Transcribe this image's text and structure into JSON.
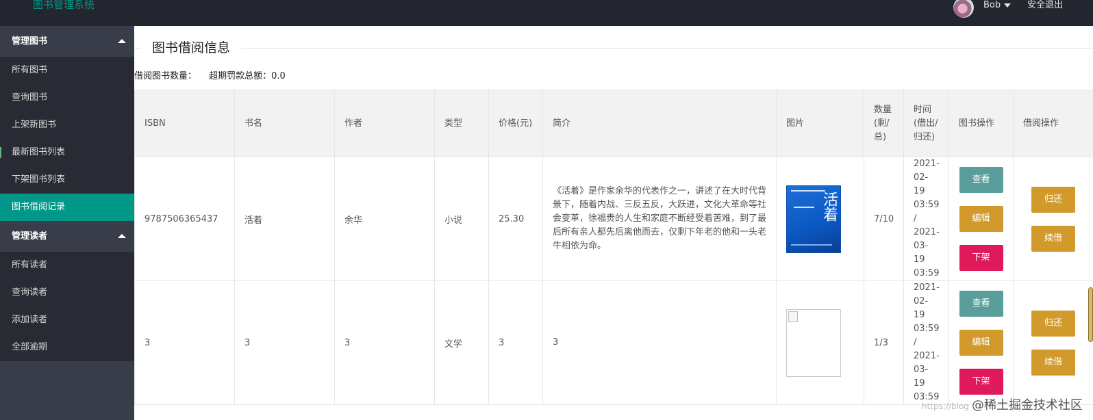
{
  "header": {
    "app_title": "图书管理系统",
    "user_name": "Bob",
    "logout_label": "安全退出"
  },
  "sidebar": {
    "groups": [
      {
        "label": "管理图书",
        "items": [
          "所有图书",
          "查询图书",
          "上架新图书",
          "最新图书列表",
          "下架图书列表",
          "图书借阅记录"
        ]
      },
      {
        "label": "管理读者",
        "items": [
          "所有读者",
          "查询读者",
          "添加读者",
          "全部逾期"
        ]
      }
    ],
    "active_item": "图书借阅记录"
  },
  "main": {
    "section_title": "图书借阅信息",
    "borrow_count_label": "借阅图书数量：",
    "fine_total_label": "超期罚款总额：0.0"
  },
  "table": {
    "headers": [
      "ISBN",
      "书名",
      "作者",
      "类型",
      "价格(元)",
      "简介",
      "图片",
      "数量(剩/总)",
      "时间(借出/归还)",
      "图书操作",
      "借阅操作"
    ],
    "rows": [
      {
        "isbn": "9787506365437",
        "title": "活着",
        "author": "余华",
        "type": "小说",
        "price": "25.30",
        "intro": "《活着》是作家余华的代表作之一，讲述了在大时代背景下，随着内战、三反五反，大跃进，文化大革命等社会变革，徐福贵的人生和家庭不断经受着苦难，到了最后所有亲人都先后离他而去，仅剩下年老的他和一头老牛相依为命。",
        "quantity": "7/10",
        "time": "2021-02-19 03:59 / 2021-03-19 03:59",
        "cover": "book-cover-blue"
      },
      {
        "isbn": "3",
        "title": "3",
        "author": "3",
        "type": "文学",
        "price": "3",
        "intro": "3",
        "quantity": "1/3",
        "time": "2021-02-19 03:59 / 2021-03-19 03:59",
        "cover": "broken-image"
      }
    ],
    "book_actions": {
      "view": "查看",
      "edit": "编辑",
      "off_shelf": "下架"
    },
    "borrow_actions": {
      "return": "归还",
      "renew": "续借"
    }
  },
  "watermark": {
    "url_text": "https://blog",
    "site": "@稀土掘金技术社区"
  },
  "colors": {
    "accent": "#009688",
    "topbar": "#23262e",
    "sidebar": "#393d49",
    "btn_view": "#5a9e9b",
    "btn_edit": "#d29a2a",
    "btn_off": "#e0195b"
  }
}
